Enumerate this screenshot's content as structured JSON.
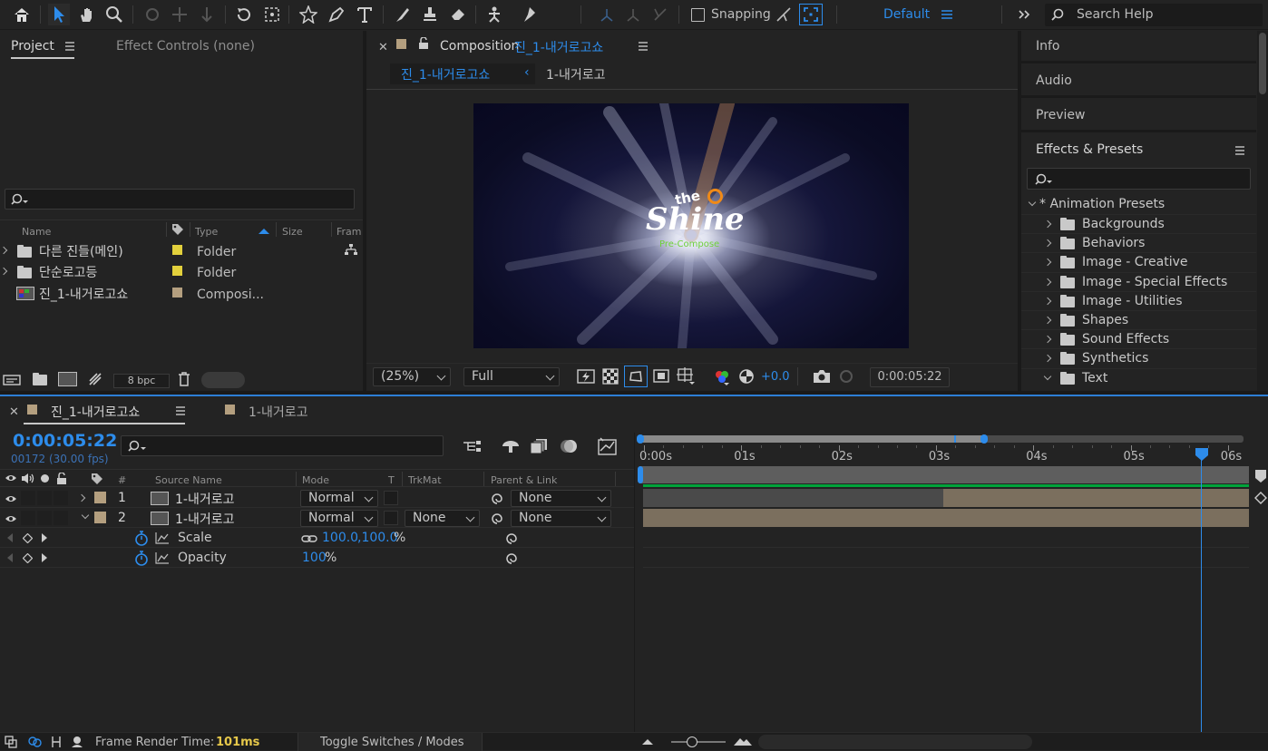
{
  "toolbar": {
    "snapping_label": "Snapping",
    "workspace_label": "Default",
    "search_placeholder": "Search Help"
  },
  "project_panel": {
    "tab_project": "Project",
    "tab_effect_controls": "Effect Controls (none)",
    "columns": {
      "name": "Name",
      "type": "Type",
      "size": "Size",
      "frame": "Fram"
    },
    "items": [
      {
        "name": "다른 진들(메인)",
        "type": "Folder",
        "label_color": "#e2d03c"
      },
      {
        "name": "단순로고등",
        "type": "Folder",
        "label_color": "#e2d03c"
      },
      {
        "name": "진_1-내거로고쇼",
        "type": "Composi...",
        "label_color": "#b49f7f"
      }
    ],
    "bpc": "8 bpc"
  },
  "composition_panel": {
    "tab_prefix": "Composition",
    "tab_comp_name": "진_1-내거로고쇼",
    "breadcrumb_active": "진_1-내거로고쇼",
    "breadcrumb_child": "1-내거로고",
    "viewer": {
      "logo_the": "the",
      "logo_shine": "Shine",
      "logo_sub": "Pre-Compose"
    },
    "zoom": "(25%)",
    "resolution": "Full",
    "exposure": "+0.0",
    "timecode": "0:00:05:22"
  },
  "right_panel": {
    "info": "Info",
    "audio": "Audio",
    "preview": "Preview",
    "effects_presets": "Effects & Presets",
    "animation_presets": "* Animation Presets",
    "folders": [
      "Backgrounds",
      "Behaviors",
      "Image - Creative",
      "Image - Special Effects",
      "Image - Utilities",
      "Shapes",
      "Sound Effects",
      "Synthetics",
      "Text"
    ]
  },
  "timeline": {
    "tab_active": "진_1-내거로고쇼",
    "tab_other": "1-내거로고",
    "current_time": "0:00:05:22",
    "frame_info": "00172 (30.00 fps)",
    "columns": {
      "num": "#",
      "source": "Source Name",
      "mode": "Mode",
      "t": "T",
      "trkmat": "TrkMat",
      "parent": "Parent & Link"
    },
    "layers": [
      {
        "num": "1",
        "name": "1-내거로고",
        "mode": "Normal",
        "trkmat": "",
        "parent": "None"
      },
      {
        "num": "2",
        "name": "1-내거로고",
        "mode": "Normal",
        "trkmat": "None",
        "parent": "None"
      }
    ],
    "props": [
      {
        "name": "Scale",
        "value": "100.0",
        "value2": ",100.0",
        "unit": " %"
      },
      {
        "name": "Opacity",
        "value": "100",
        "unit": " %"
      }
    ],
    "ruler": [
      "0:00s",
      "01s",
      "02s",
      "03s",
      "04s",
      "05s",
      "06s"
    ],
    "playhead_seconds": 5.73
  },
  "status_bar": {
    "render_label": "Frame Render Time:",
    "render_value": "101ms",
    "toggle_label": "Toggle Switches / Modes"
  },
  "colors": {
    "accent": "#2d8ceb",
    "panel": "#232323",
    "dark": "#1a1a1a",
    "layer_bar": "#7b6f5e",
    "layer_bar_dark": "#4a4a4a",
    "green": "#00a33a"
  }
}
